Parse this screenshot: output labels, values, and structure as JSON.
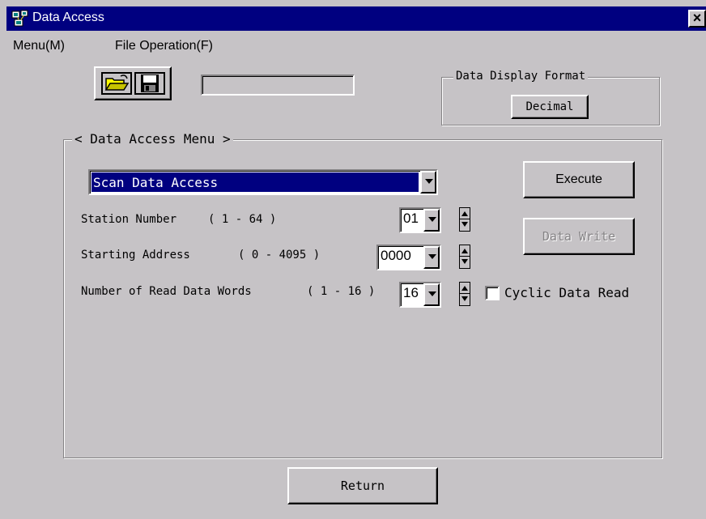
{
  "window": {
    "title": "Data Access",
    "close_label": "×"
  },
  "menubar": {
    "items": [
      {
        "label": "Menu(M)"
      },
      {
        "label": "File Operation(F)"
      }
    ]
  },
  "toolbar": {
    "icons": [
      "open-folder-icon",
      "save-disk-icon"
    ],
    "status_value": ""
  },
  "display_format": {
    "group_label": "Data Display Format",
    "button_label": "Decimal"
  },
  "access_menu": {
    "group_label": "< Data Access Menu >",
    "selected_option": "Scan Data Access",
    "execute_label": "Execute",
    "data_write_label": "Data Write",
    "fields": {
      "station": {
        "label": "Station Number",
        "range": "( 1 - 64 )",
        "value": "01"
      },
      "address": {
        "label": "Starting Address",
        "range": "( 0 - 4095 )",
        "value": "0000"
      },
      "words": {
        "label": "Number of Read Data Words",
        "range": "( 1 - 16 )",
        "value": "16"
      }
    },
    "cyclic_label": "Cyclic Data Read",
    "cyclic_checked": false
  },
  "return_label": "Return",
  "colors": {
    "titlebar": "#000080",
    "face": "#c6c3c6",
    "selection": "#000080",
    "disabled_text": "#848284"
  }
}
